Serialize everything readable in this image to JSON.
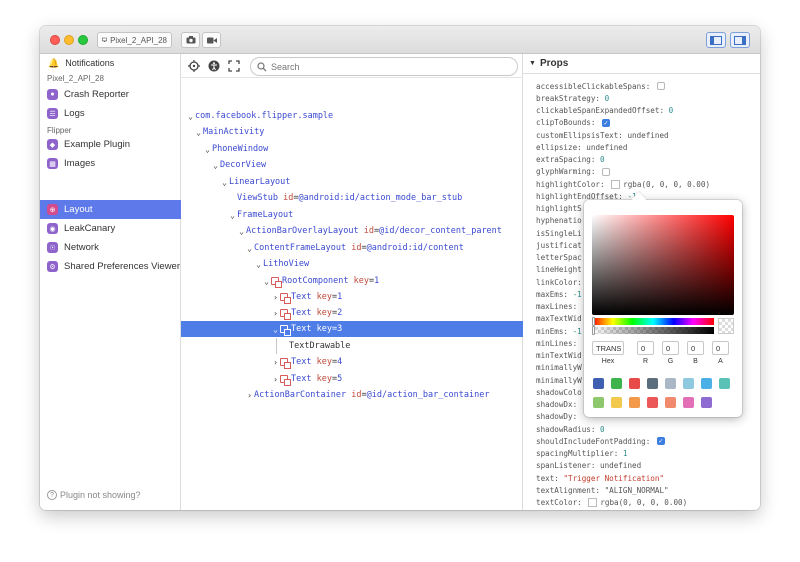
{
  "titlebar": {
    "device": "Pixel_2_API_28"
  },
  "sidebar": {
    "notifications": "Notifications",
    "device_section": "Pixel_2_API_28",
    "device_items": [
      {
        "label": "Crash Reporter",
        "icon": "crash-icon"
      },
      {
        "label": "Logs",
        "icon": "logs-icon"
      }
    ],
    "flipper_section": "Flipper",
    "flipper_items": [
      {
        "label": "Example Plugin",
        "icon": "plugin-icon"
      },
      {
        "label": "Images",
        "icon": "images-icon"
      },
      {
        "label": "Layout",
        "icon": "layout-icon",
        "active": true
      },
      {
        "label": "LeakCanary",
        "icon": "leak-icon"
      },
      {
        "label": "Network",
        "icon": "network-icon"
      },
      {
        "label": "Shared Preferences Viewer",
        "icon": "prefs-icon"
      }
    ],
    "footer": "Plugin not showing?"
  },
  "tree": {
    "search_placeholder": "Search",
    "rows": [
      {
        "name": "com.facebook.flipper.sample"
      },
      {
        "name": "MainActivity"
      },
      {
        "name": "PhoneWindow"
      },
      {
        "name": "DecorView"
      },
      {
        "name": "LinearLayout"
      },
      {
        "name": "ViewStub",
        "attr": "id",
        "value": "@android:id/action_mode_bar_stub"
      },
      {
        "name": "FrameLayout"
      },
      {
        "name": "ActionBarOverlayLayout",
        "attr": "id",
        "value": "@id/decor_content_parent"
      },
      {
        "name": "ContentFrameLayout",
        "attr": "id",
        "value": "@android:id/content"
      },
      {
        "name": "LithoView"
      },
      {
        "name": "RootComponent",
        "attr": "key",
        "value": "1"
      },
      {
        "name": "Text",
        "attr": "key",
        "value": "1"
      },
      {
        "name": "Text",
        "attr": "key",
        "value": "2"
      },
      {
        "name": "Text",
        "attr": "key",
        "value": "3"
      },
      {
        "name": "TextDrawable"
      },
      {
        "name": "Text",
        "attr": "key",
        "value": "4"
      },
      {
        "name": "Text",
        "attr": "key",
        "value": "5"
      },
      {
        "name": "ActionBarContainer",
        "attr": "id",
        "value": "@id/action_bar_container"
      }
    ]
  },
  "props": {
    "header": "Props",
    "items": [
      {
        "key": "accessibleClickableSpans:",
        "type": "check",
        "value": false
      },
      {
        "key": "breakStrategy:",
        "type": "num",
        "value": "0"
      },
      {
        "key": "clickableSpanExpandedOffset:",
        "type": "num",
        "value": "0"
      },
      {
        "key": "clipToBounds:",
        "type": "check",
        "value": true
      },
      {
        "key": "customEllipsisText:",
        "type": "und",
        "value": "undefined"
      },
      {
        "key": "ellipsize:",
        "type": "und",
        "value": "undefined"
      },
      {
        "key": "extraSpacing:",
        "type": "num",
        "value": "0"
      },
      {
        "key": "glyphWarming:",
        "type": "check",
        "value": false
      },
      {
        "key": "highlightColor:",
        "type": "color",
        "value": "rgba(0, 0, 0, 0.00)"
      },
      {
        "key": "highlightEndOffset:",
        "type": "num",
        "value": "-1"
      },
      {
        "key": "highlightS",
        "type": "none",
        "value": ""
      },
      {
        "key": "hyphenatio",
        "type": "none",
        "value": ""
      },
      {
        "key": "isSingleLi",
        "type": "none",
        "value": ""
      },
      {
        "key": "justificat",
        "type": "none",
        "value": ""
      },
      {
        "key": "letterSpac",
        "type": "none",
        "value": ""
      },
      {
        "key": "lineHeight",
        "type": "none",
        "value": ""
      },
      {
        "key": "linkColor:",
        "type": "none",
        "value": ""
      },
      {
        "key": "maxEms:",
        "type": "num",
        "value": "-1"
      },
      {
        "key": "maxLines:",
        "type": "none",
        "value": ""
      },
      {
        "key": "maxTextWid",
        "type": "none",
        "value": ""
      },
      {
        "key": "minEms:",
        "type": "num",
        "value": "-1"
      },
      {
        "key": "minLines:",
        "type": "none",
        "value": ""
      },
      {
        "key": "minTextWid",
        "type": "none",
        "value": ""
      },
      {
        "key": "minimallyW",
        "type": "none",
        "value": ""
      },
      {
        "key": "minimallyW",
        "type": "none",
        "value": ""
      },
      {
        "key": "shadowColo",
        "type": "none",
        "value": ""
      },
      {
        "key": "shadowDx:",
        "type": "none",
        "value": ""
      },
      {
        "key": "shadowDy:",
        "type": "none",
        "value": ""
      },
      {
        "key": "shadowRadius:",
        "type": "num",
        "value": "0"
      },
      {
        "key": "shouldIncludeFontPadding:",
        "type": "check",
        "value": true
      },
      {
        "key": "spacingMultiplier:",
        "type": "num",
        "value": "1"
      },
      {
        "key": "spanListener:",
        "type": "und",
        "value": "undefined"
      },
      {
        "key": "text:",
        "type": "str",
        "value": "\"Trigger Notification\""
      },
      {
        "key": "textAlignment:",
        "type": "und",
        "value": "\"ALIGN_NORMAL\""
      },
      {
        "key": "textColor:",
        "type": "color",
        "value": "rgba(0, 0, 0, 0.00)"
      }
    ]
  },
  "picker": {
    "hex_value": "TRANS",
    "r": "0",
    "g": "0",
    "b": "0",
    "a": "0",
    "labels": {
      "hex": "Hex",
      "r": "R",
      "g": "G",
      "b": "B",
      "a": "A"
    },
    "presets": [
      "#3f5fb0",
      "#3cb44b",
      "#e84a4a",
      "#5b6e7d",
      "#a9b7c6",
      "#8fc9e0",
      "#4cb0e6",
      "#59c1b6",
      "#8dc86e",
      "#f2c94c",
      "#f2994a",
      "#eb5757",
      "#f28b6e",
      "#e36fb6",
      "#8d6bd1"
    ]
  }
}
